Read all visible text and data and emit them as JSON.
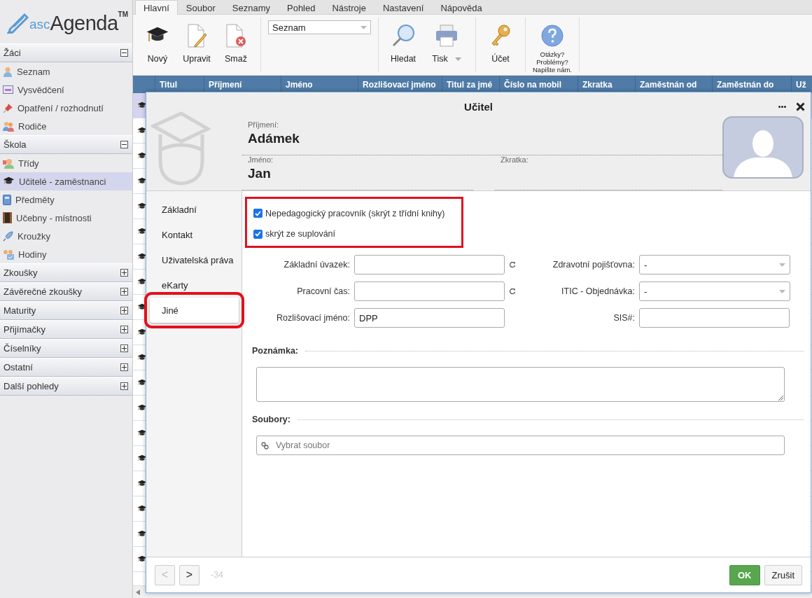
{
  "logo": {
    "prefix": "asc",
    "name": "Agenda",
    "mark": "TM"
  },
  "sidebar": [
    {
      "label": "Žáci",
      "expanded": true,
      "items": [
        {
          "label": "Seznam",
          "selected": false
        },
        {
          "label": "Vysvědčení",
          "selected": false
        },
        {
          "label": "Opatření / rozhodnutí",
          "selected": false
        },
        {
          "label": "Rodiče",
          "selected": false
        }
      ]
    },
    {
      "label": "Škola",
      "expanded": true,
      "items": [
        {
          "label": "Třídy",
          "selected": false
        },
        {
          "label": "Učitelé - zaměstnanci",
          "selected": true
        },
        {
          "label": "Předměty",
          "selected": false
        },
        {
          "label": "Učebny - místnosti",
          "selected": false
        },
        {
          "label": "Kroužky",
          "selected": false
        },
        {
          "label": "Hodiny",
          "selected": false
        }
      ]
    },
    {
      "label": "Zkoušky",
      "expanded": false
    },
    {
      "label": "Závěrečné zkoušky",
      "expanded": false
    },
    {
      "label": "Maturity",
      "expanded": false
    },
    {
      "label": "Přijímačky",
      "expanded": false
    },
    {
      "label": "Číselníky",
      "expanded": false
    },
    {
      "label": "Ostatní",
      "expanded": false
    },
    {
      "label": "Další pohledy",
      "expanded": false
    }
  ],
  "menu_tabs": [
    {
      "label": "Hlavní",
      "selected": true
    },
    {
      "label": "Soubor",
      "selected": false
    },
    {
      "label": "Seznamy",
      "selected": false
    },
    {
      "label": "Pohled",
      "selected": false
    },
    {
      "label": "Nástroje",
      "selected": false
    },
    {
      "label": "Nastavení",
      "selected": false
    },
    {
      "label": "Nápověda",
      "selected": false
    }
  ],
  "toolbar": [
    {
      "items": [
        {
          "kind": "button",
          "label": "Nový"
        },
        {
          "kind": "button",
          "label": "Upravit"
        },
        {
          "kind": "button",
          "label": "Smaž"
        }
      ]
    },
    {
      "items": [
        {
          "kind": "select",
          "value": "Seznam"
        }
      ]
    },
    {
      "items": [
        {
          "kind": "button",
          "label": "Hledat"
        },
        {
          "kind": "dropdown",
          "label": "Tisk"
        }
      ]
    },
    {
      "items": [
        {
          "kind": "button",
          "label": "Účet"
        }
      ]
    },
    {
      "items": [
        {
          "kind": "help",
          "label": "Otázky?\nProblémy?\nNapište nám."
        }
      ]
    }
  ],
  "table": {
    "columns": [
      "Titul",
      "Příjmení",
      "Jméno",
      "Rozlišovací jméno",
      "Titul za jmé",
      "Číslo na mobil",
      "Zkratka",
      "Zaměstnán od",
      "Zaměstnán do",
      "Už"
    ],
    "rows": [
      {
        "selected": true
      },
      {
        "selected": false
      },
      {
        "selected": false
      },
      {
        "selected": false
      },
      {
        "selected": false
      },
      {
        "selected": false
      },
      {
        "selected": false
      },
      {
        "selected": false
      },
      {
        "selected": false
      },
      {
        "selected": false
      },
      {
        "selected": false
      },
      {
        "selected": false
      },
      {
        "selected": false
      },
      {
        "selected": false
      },
      {
        "selected": false
      },
      {
        "selected": false
      },
      {
        "selected": false
      },
      {
        "selected": false
      },
      {
        "selected": false
      }
    ]
  },
  "dialog": {
    "title": "Učitel",
    "header_fields": [
      {
        "label": "Příjmení:",
        "value": "Adámek"
      },
      {
        "label": "Jméno:",
        "value": "Jan"
      },
      {
        "label": "Zkratka:"
      }
    ],
    "nav": [
      {
        "label": "Základní",
        "selected": false,
        "highlighted": false
      },
      {
        "label": "Kontakt",
        "selected": false,
        "highlighted": false
      },
      {
        "label": "Uživatelská práva",
        "selected": false,
        "highlighted": false
      },
      {
        "label": "eKarty",
        "selected": false,
        "highlighted": false
      },
      {
        "label": "Jiné",
        "selected": true,
        "highlighted": true
      }
    ],
    "flags": {
      "highlighted": true,
      "items": [
        {
          "label": "Nepedagogický pracovník (skrýt z třídní knihy)",
          "checked": true
        },
        {
          "label": "skrýt ze suplování",
          "checked": true
        }
      ]
    },
    "fields": [
      {
        "label": "Základní úvazek:",
        "kind": "input",
        "resettable": true
      },
      {
        "label": "Zdravotní pojišťovna:",
        "kind": "select",
        "value": "-"
      },
      {
        "label": "Pracovní čas:",
        "kind": "input",
        "resettable": true
      },
      {
        "label": "ITIC - Objednávka:",
        "kind": "select",
        "value": "-"
      },
      {
        "label": "Rozlišovací jméno:",
        "kind": "input",
        "value": "DPP"
      },
      {
        "label": "SIS#:",
        "kind": "input"
      }
    ],
    "sections": [
      {
        "title": "Poznámka:",
        "kind": "textarea"
      },
      {
        "title": "Soubory:",
        "kind": "file",
        "placeholder": "Vybrat soubor"
      }
    ],
    "footer": {
      "prev": {
        "label": "<",
        "disabled": true
      },
      "next": {
        "label": ">",
        "disabled": false
      },
      "counter": "-34",
      "ok": "OK",
      "cancel": "Zrušit"
    }
  }
}
